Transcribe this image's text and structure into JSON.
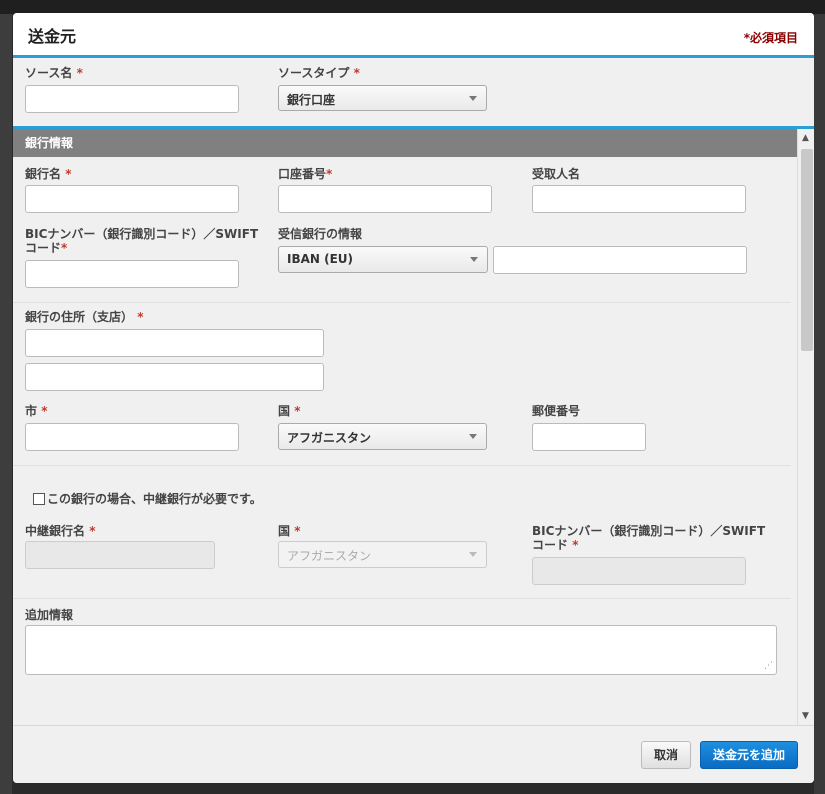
{
  "modal": {
    "title": "送金元",
    "required_note": "*必須項目"
  },
  "source": {
    "name_label": "ソース名",
    "type_label": "ソースタイプ",
    "type_value": "銀行口座",
    "star": "*"
  },
  "bank_info": {
    "section_title": "銀行情報",
    "bank_name_label": "銀行名",
    "account_number_label": "口座番号",
    "recipient_name_label": "受取人名",
    "bic_label_line1": "BICナンバー（銀行識別コード）／SWIFT",
    "bic_label_line2": "コード",
    "receiving_bank_label": "受信銀行の情報",
    "receiving_bank_select": "IBAN (EU)",
    "address_label": "銀行の住所（支店）",
    "city_label": "市",
    "country_label": "国",
    "country_value": "アフガニスタン",
    "postal_label": "郵便番号",
    "star": "*"
  },
  "intermediary": {
    "checkbox_label": "この銀行の場合、中継銀行が必要です。",
    "name_label": "中継銀行名",
    "country_label": "国",
    "country_value": "アフガニスタン",
    "bic_label_line1": "BICナンバー（銀行識別コード）／SWIFT",
    "bic_label_line2": "コード",
    "star": "*"
  },
  "additional": {
    "label": "追加情報"
  },
  "footer": {
    "cancel_label": "取消",
    "submit_label": "送金元を追加"
  },
  "colors": {
    "accent_blue": "#2a9fd6",
    "section_gray": "#808080",
    "required_red": "#c0392b",
    "primary_button": "#0a6cc2"
  }
}
